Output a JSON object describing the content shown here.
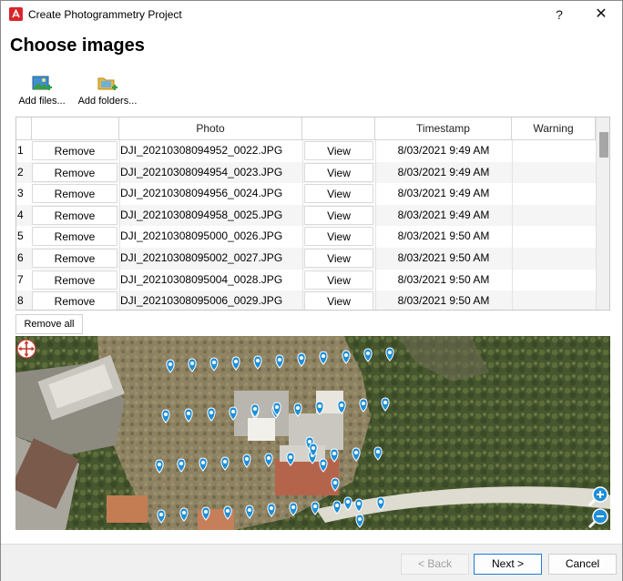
{
  "window": {
    "title": "Create Photogrammetry Project",
    "help_label": "?",
    "close_label": "✕"
  },
  "page": {
    "heading": "Choose images"
  },
  "toolbar": {
    "add_files_label": "Add files...",
    "add_folders_label": "Add folders..."
  },
  "table": {
    "columns": [
      "",
      "",
      "Photo",
      "",
      "Timestamp",
      "Warning"
    ],
    "remove_label": "Remove",
    "view_label": "View",
    "rows": [
      {
        "num": "1",
        "photo": "DJI_20210308094952_0022.JPG",
        "timestamp": "8/03/2021 9:49 AM",
        "warning": ""
      },
      {
        "num": "2",
        "photo": "DJI_20210308094954_0023.JPG",
        "timestamp": "8/03/2021 9:49 AM",
        "warning": ""
      },
      {
        "num": "3",
        "photo": "DJI_20210308094956_0024.JPG",
        "timestamp": "8/03/2021 9:49 AM",
        "warning": ""
      },
      {
        "num": "4",
        "photo": "DJI_20210308094958_0025.JPG",
        "timestamp": "8/03/2021 9:49 AM",
        "warning": ""
      },
      {
        "num": "5",
        "photo": "DJI_20210308095000_0026.JPG",
        "timestamp": "8/03/2021 9:50 AM",
        "warning": ""
      },
      {
        "num": "6",
        "photo": "DJI_20210308095002_0027.JPG",
        "timestamp": "8/03/2021 9:50 AM",
        "warning": ""
      },
      {
        "num": "7",
        "photo": "DJI_20210308095004_0028.JPG",
        "timestamp": "8/03/2021 9:50 AM",
        "warning": ""
      },
      {
        "num": "8",
        "photo": "DJI_20210308095006_0029.JPG",
        "timestamp": "8/03/2021 9:50 AM",
        "warning": ""
      }
    ],
    "remove_all_label": "Remove all"
  },
  "map": {
    "pan_icon": "move-arrows-icon",
    "zoom_in_icon": "zoom-in-icon",
    "zoom_out_icon": "zoom-out-icon",
    "marker_color": "#1f8fd8"
  },
  "footer": {
    "back_label": "< Back",
    "next_label": "Next >",
    "cancel_label": "Cancel"
  }
}
